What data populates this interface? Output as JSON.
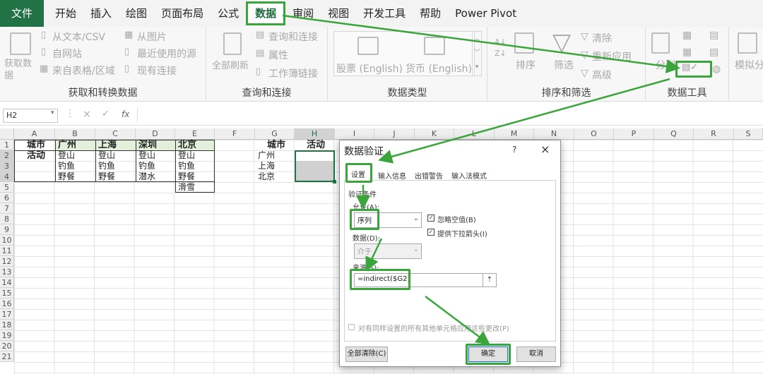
{
  "tabs": [
    "文件",
    "开始",
    "插入",
    "绘图",
    "页面布局",
    "公式",
    "数据",
    "审阅",
    "视图",
    "开发工具",
    "帮助",
    "Power Pivot"
  ],
  "ribbon": {
    "g1": {
      "label": "获取和转换数据",
      "get_data": "获取数据",
      "from_text": "从文本/CSV",
      "from_web": "自网站",
      "from_table": "来自表格/区域",
      "from_picture": "从图片",
      "recent": "最近使用的源",
      "existing": "现有连接"
    },
    "g2": {
      "label": "查询和连接",
      "refresh_all": "全部刷新",
      "queries": "查询和连接",
      "properties": "属性",
      "workbook_links": "工作簿链接"
    },
    "g3": {
      "label": "数据类型",
      "stocks": "股票 (English)",
      "currency": "货币 (English)"
    },
    "g4": {
      "label": "排序和筛选",
      "sort": "排序",
      "filter": "筛选",
      "clear": "清除",
      "reapply": "重新应用",
      "advanced": "高级"
    },
    "g5": {
      "label": "数据工具",
      "text_to_col": "分列"
    },
    "g6": {
      "what_if": "模拟分"
    }
  },
  "formula_bar": {
    "namebox": "H2",
    "cancel": "×",
    "confirm": "✓",
    "fx": "fx"
  },
  "columns": [
    "A",
    "B",
    "C",
    "D",
    "E",
    "F",
    "G",
    "H",
    "I",
    "J",
    "K",
    "L",
    "M",
    "N",
    "O",
    "P",
    "Q",
    "R",
    "S"
  ],
  "rows": [
    "1",
    "2",
    "3",
    "4",
    "5",
    "6",
    "7",
    "8",
    "9",
    "10",
    "11",
    "12",
    "13",
    "14",
    "15",
    "16",
    "17",
    "18",
    "19",
    "20",
    "21"
  ],
  "cells": {
    "a1": "城市",
    "a2": "活动",
    "b1": "广州",
    "c1": "上海",
    "d1": "深圳",
    "e1": "北京",
    "b2": "登山",
    "c2": "登山",
    "d2": "登山",
    "e2": "登山",
    "b3": "钓鱼",
    "c3": "钓鱼",
    "d3": "钓鱼",
    "e3": "钓鱼",
    "b4": "野餐",
    "c4": "野餐",
    "d4": "潜水",
    "e4": "野餐",
    "e5": "滑雪",
    "g1": "城市",
    "h1": "活动",
    "g2": "广州",
    "g3": "上海",
    "g4": "北京"
  },
  "dialog": {
    "title": "数据验证",
    "help": "?",
    "close": "×",
    "tabs": [
      "设置",
      "输入信息",
      "出错警告",
      "输入法模式"
    ],
    "criteria": "验证条件",
    "allow_label": "允许(A):",
    "allow_value": "序列",
    "ignore_blank": "忽略空值(B)",
    "dropdown": "提供下拉箭头(I)",
    "data_label": "数据(D):",
    "data_value": "介于",
    "source_label": "来源(S):",
    "source_value": "=indirect($G2)",
    "apply_all": "对有同样设置的所有其他单元格应用这些更改(P)",
    "clear_all": "全部清除(C)",
    "ok": "确定",
    "cancel": "取消"
  },
  "colors": {
    "accent": "#3aa53a",
    "excel_green": "#217346",
    "header_fill": "#e2efda"
  }
}
